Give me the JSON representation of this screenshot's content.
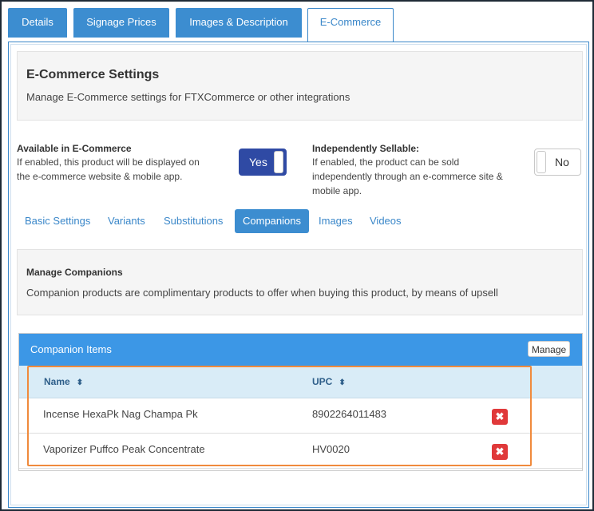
{
  "tabs": [
    {
      "label": "Details"
    },
    {
      "label": "Signage Prices"
    },
    {
      "label": "Images & Description"
    },
    {
      "label": "E-Commerce"
    }
  ],
  "header": {
    "title": "E-Commerce Settings",
    "subtitle": "Manage E-Commerce settings for FTXCommerce or other integrations"
  },
  "settings": {
    "available": {
      "title": "Available in E-Commerce",
      "desc_line1": "If enabled, this product will be displayed on",
      "desc_line2": "the e-commerce website & mobile app.",
      "toggle_label": "Yes",
      "enabled": true
    },
    "sellable": {
      "title": "Independently Sellable:",
      "desc_line1": "If enabled, the product can be sold",
      "desc_line2": "independently through an e-commerce site &",
      "desc_line3": "mobile app.",
      "toggle_label": "No",
      "enabled": false
    }
  },
  "subtabs": [
    {
      "label": "Basic Settings"
    },
    {
      "label": "Variants"
    },
    {
      "label": "Substitutions"
    },
    {
      "label": "Companions"
    },
    {
      "label": "Images"
    },
    {
      "label": "Videos"
    }
  ],
  "companions_info": {
    "title": "Manage Companions",
    "desc": "Companion products are complimentary products to offer when buying this product, by means of upsell"
  },
  "grid": {
    "title": "Companion Items",
    "manage_label": "Manage",
    "columns": [
      {
        "label": "Name",
        "sort_icon": "sort-icon"
      },
      {
        "label": "UPC",
        "sort_icon": "sort-icon"
      }
    ],
    "rows": [
      {
        "name": "Incense HexaPk Nag Champa Pk",
        "upc": "8902264011483"
      },
      {
        "name": "Vaporizer Puffco Peak Concentrate",
        "upc": "HV0020"
      }
    ],
    "delete_glyph": "✖",
    "sort_glyph": "⬍"
  },
  "colors": {
    "accent": "#3c8dd0",
    "toggle_on": "#2f4aa4",
    "delete": "#e0393a",
    "highlight": "#f08a3c"
  }
}
